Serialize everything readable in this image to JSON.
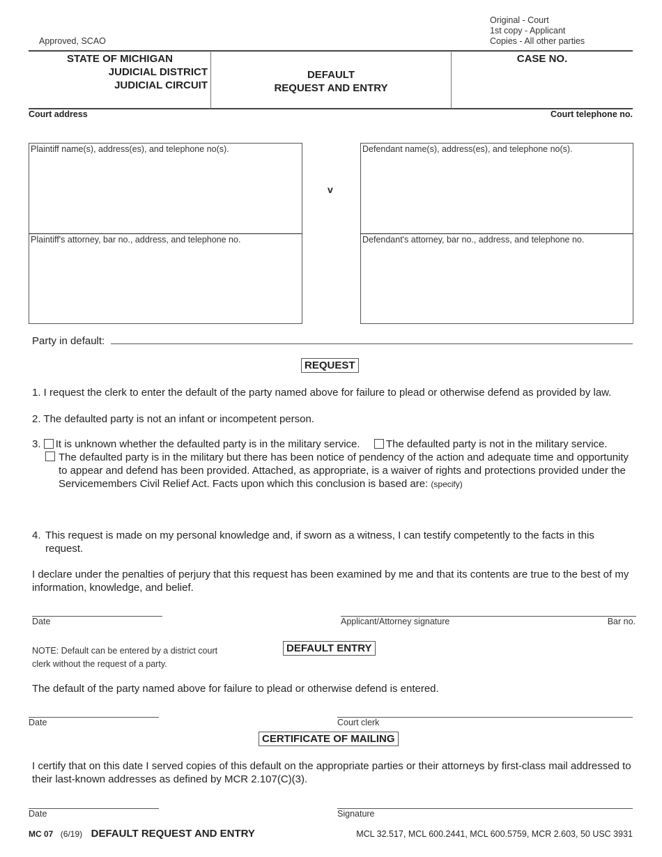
{
  "header": {
    "approved": "Approved, SCAO",
    "distribution": [
      "Original - Court",
      "1st copy - Applicant",
      "Copies - All other parties"
    ],
    "state": "STATE OF MICHIGAN",
    "district": "JUDICIAL DISTRICT",
    "circuit": "JUDICIAL CIRCUIT",
    "title_line1": "DEFAULT",
    "title_line2": "REQUEST AND ENTRY",
    "case_no_label": "CASE NO.",
    "case_no_value": "",
    "court_address_label": "Court address",
    "court_telephone_label": "Court telephone no."
  },
  "parties": {
    "plaintiff_label": "Plaintiff name(s), address(es), and telephone no(s).",
    "plaintiff_attorney_label": "Plaintiff's attorney, bar no., address, and telephone no.",
    "versus": "v",
    "defendant_label": "Defendant name(s), address(es), and telephone no(s).",
    "defendant_attorney_label": "Defendant's attorney, bar no., address, and telephone no.",
    "plaintiff_value": "",
    "plaintiff_attorney_value": "",
    "defendant_value": "",
    "defendant_attorney_value": ""
  },
  "party_in_default": {
    "label": "Party in default:",
    "value": ""
  },
  "request": {
    "title": "REQUEST",
    "item1": "1. I request the clerk to enter the default of the party named above for failure to plead or otherwise defend as provided by law.",
    "item2": "2. The defaulted party is not an infant or incompetent person.",
    "item3_num": "3.",
    "item3_opt_a": "It is unknown whether the defaulted party is in the military service.",
    "item3_opt_b": "The defaulted party is not in the military service.",
    "item3_opt_c": "The defaulted party is in the military but there has been notice of pendency of the action and adequate time and opportunity to appear and defend has been provided. Attached, as appropriate, is a waiver of rights and protections provided under the Servicemembers Civil Relief Act. Facts upon which this conclusion is based are:",
    "item3_specify": "(specify)",
    "item4_num": "4.",
    "item4": "This request is made on my personal knowledge and, if sworn as a witness, I can testify competently to the facts in this request.",
    "declaration": "I declare under the penalties of perjury that this request has been examined by me and that its contents are true to the best of my information, knowledge, and belief.",
    "date_label": "Date",
    "signature_label": "Applicant/Attorney signature",
    "bar_no_label": "Bar no."
  },
  "default_entry": {
    "note": "NOTE: Default can be entered by a district court clerk without the request of a party.",
    "note_line1": "NOTE: Default can be entered by a district court",
    "note_line2": "clerk without the request of a party.",
    "title": "DEFAULT ENTRY",
    "statement": "The default of the party named above for failure to plead or otherwise defend is entered.",
    "date_label": "Date",
    "clerk_label": "Court clerk"
  },
  "certificate": {
    "title": "CERTIFICATE OF MAILING",
    "statement": "I certify that on this date I served copies of this default on the appropriate parties or their attorneys by first-class mail addressed to their last-known addresses as defined by MCR 2.107(C)(3).",
    "date_label": "Date",
    "signature_label": "Signature"
  },
  "footer": {
    "form_no": "MC 07",
    "revision": "(6/19)",
    "form_title": "DEFAULT REQUEST AND ENTRY",
    "citations": "MCL 32.517, MCL 600.2441, MCL 600.5759, MCR 2.603, 50 USC 3931"
  }
}
